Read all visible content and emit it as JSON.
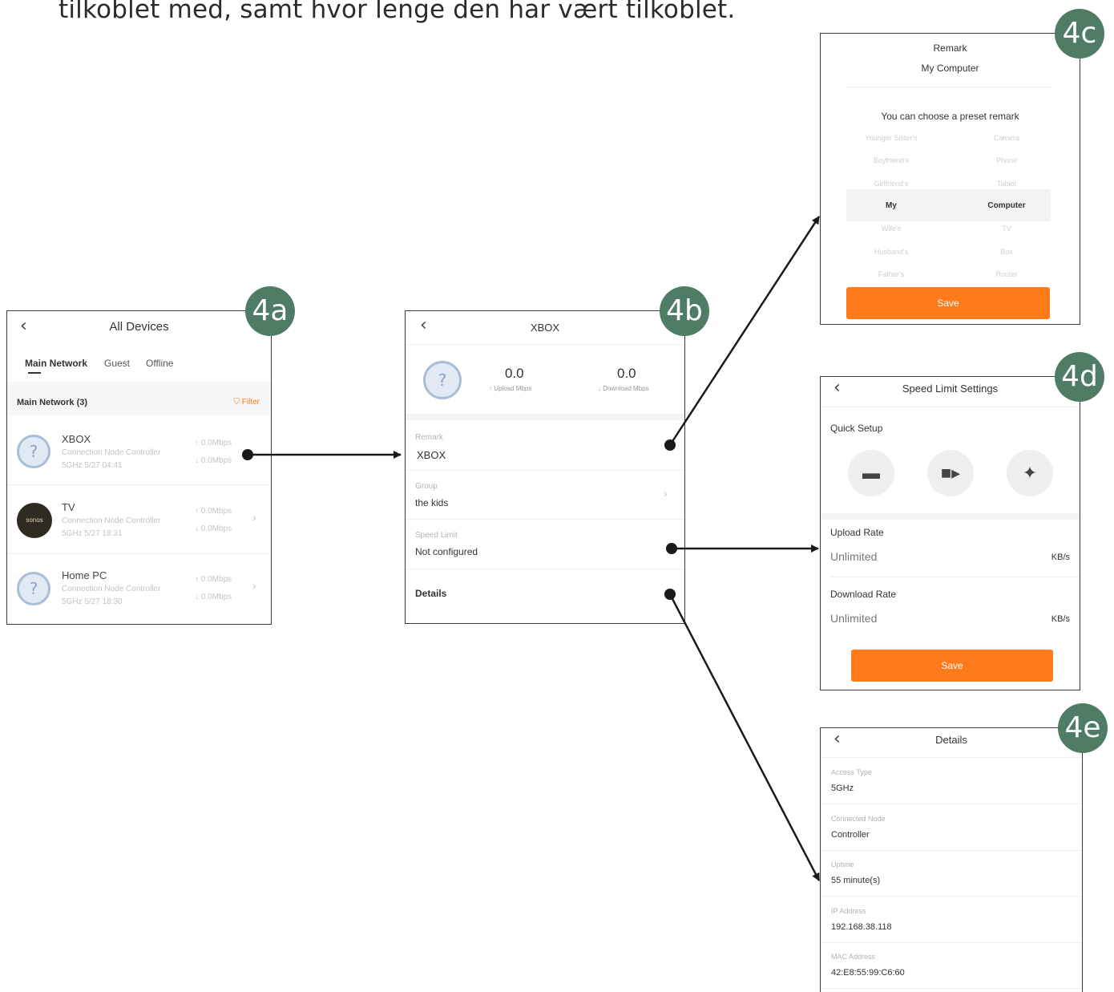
{
  "intro_text": "tilkoblet med, samt hvor lenge den har vært tilkoblet.",
  "badges": {
    "a": "4a",
    "b": "4b",
    "c": "4c",
    "d": "4d",
    "e": "4e"
  },
  "screen_4a": {
    "title": "All Devices",
    "tabs": [
      "Main Network",
      "Guest",
      "Offline"
    ],
    "section_label": "Main Network (3)",
    "filter_label": "Filter",
    "devices": [
      {
        "name": "XBOX",
        "sub1": "Connection Node Controller",
        "sub2": "5GHz  5/27 04:41",
        "up": "↑ 0.0Mbps",
        "down": "↓ 0.0Mbps"
      },
      {
        "name": "TV",
        "sub1": "Connection Node Controller",
        "sub2": "5GHz  5/27 18:31",
        "up": "↑ 0.0Mbps",
        "down": "↓ 0.0Mbps",
        "avatar_text": "sonos"
      },
      {
        "name": "Home PC",
        "sub1": "Connection Node Controller",
        "sub2": "5GHz  5/27 18:30",
        "up": "↑ 0.0Mbps",
        "down": "↓ 0.0Mbps"
      }
    ]
  },
  "screen_4b": {
    "title": "XBOX",
    "upload_value": "0.0",
    "upload_label": "↑ Upload Mbps",
    "download_value": "0.0",
    "download_label": "↓ Download Mbps",
    "rows": [
      {
        "label": "Remark",
        "value": "XBOX"
      },
      {
        "label": "Group",
        "value": "the kids"
      },
      {
        "label": "Speed Limit",
        "value": "Not configured"
      },
      {
        "label": "",
        "value": "Details"
      }
    ]
  },
  "screen_4c": {
    "title": "Remark",
    "current": "My Computer",
    "prompt": "You can choose a preset remark",
    "left_options": [
      "Younger Sister's",
      "Boyfriend's",
      "Girlfriend's",
      "My",
      "Wife's",
      "Husband's",
      "Father's"
    ],
    "right_options": [
      "Camera",
      "Phone",
      "Tablet",
      "Computer",
      "TV",
      "Box",
      "Router"
    ],
    "selected_index": 3,
    "save_label": "Save"
  },
  "screen_4d": {
    "title": "Speed Limit Settings",
    "quick_setup_label": "Quick Setup",
    "quick_icons": [
      "laptop-icon",
      "video-icon",
      "gamepad-icon"
    ],
    "upload_label": "Upload Rate",
    "upload_value": "Unlimited",
    "upload_unit": "KB/s",
    "download_label": "Download Rate",
    "download_value": "Unlimited",
    "download_unit": "KB/s",
    "save_label": "Save"
  },
  "screen_4e": {
    "title": "Details",
    "rows": [
      {
        "label": "Access Type",
        "value": "5GHz"
      },
      {
        "label": "Connected Node",
        "value": "Controller"
      },
      {
        "label": "Uptime",
        "value": "55 minute(s)"
      },
      {
        "label": "IP Address",
        "value": "192.168.38.118"
      },
      {
        "label": "MAC Address",
        "value": "42:E8:55:99:C6:60"
      }
    ]
  },
  "colors": {
    "badge": "#4e7c65",
    "accent": "#ff7a1a",
    "arrow": "#1a1a1a"
  }
}
